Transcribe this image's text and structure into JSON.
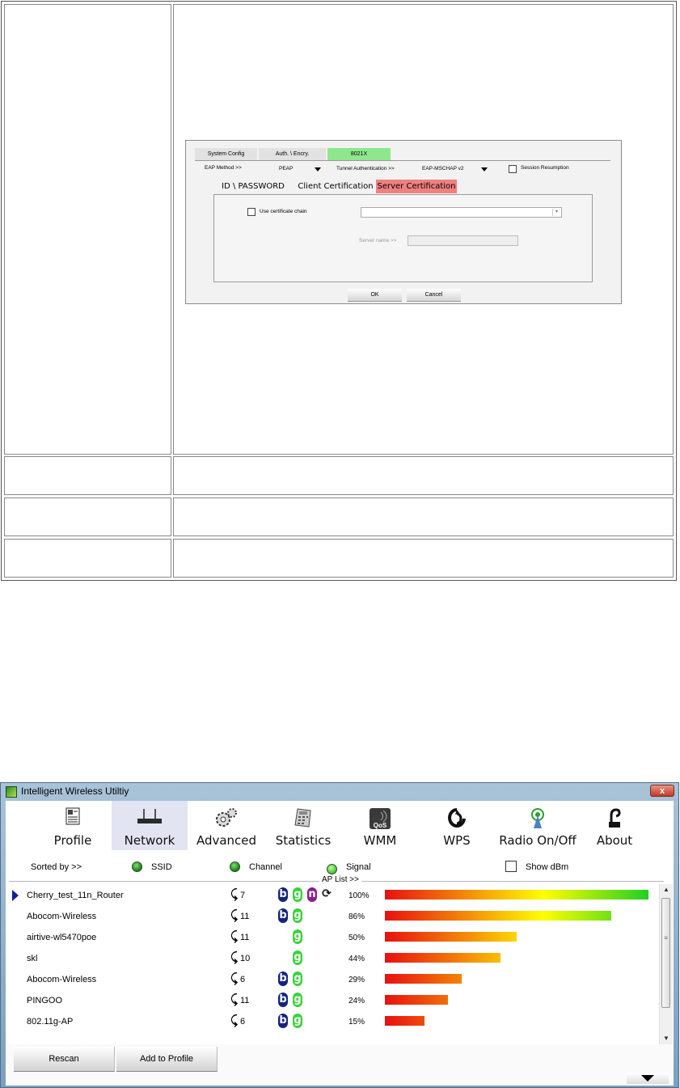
{
  "dialog": {
    "tabs": [
      "System Config",
      "Auth. \\ Encry.",
      "8021X"
    ],
    "eap_method_label": "EAP Method >>",
    "eap_method_value": "PEAP",
    "tunnel_auth_label": "Tunnel Authentication >>",
    "tunnel_auth_value": "EAP-MSCHAP v2",
    "session_resumption_label": "Session Resumption",
    "subtabs": [
      "ID \\ PASSWORD",
      "Client Certification",
      "Server Certification"
    ],
    "use_cert_chain_label": "Use certificate chain",
    "server_name_label": "Server name >>",
    "ok_label": "OK",
    "cancel_label": "Cancel",
    "colors": {
      "active_tab": "#8de88d",
      "server_cert_tab": "#f08080"
    }
  },
  "app": {
    "title": "Intelligent Wireless Utiltiy",
    "close_label": "x",
    "toolbar": [
      {
        "label": "Profile",
        "icon": "profile-icon"
      },
      {
        "label": "Network",
        "icon": "network-icon",
        "active": true
      },
      {
        "label": "Advanced",
        "icon": "advanced-gear-icon"
      },
      {
        "label": "Statistics",
        "icon": "statistics-calculator-icon"
      },
      {
        "label": "WMM",
        "icon": "wmm-qos-icon"
      },
      {
        "label": "WPS",
        "icon": "wps-icon"
      },
      {
        "label": "Radio On/Off",
        "icon": "radio-antenna-icon"
      },
      {
        "label": "About",
        "icon": "about-icon"
      }
    ],
    "sort": {
      "sorted_by": "Sorted by >>",
      "ssid": "SSID",
      "channel": "Channel",
      "signal": "Signal",
      "show_dbm": "Show dBm"
    },
    "ap_list_label": "AP List >>",
    "networks": [
      {
        "ssid": "Cherry_test_11n_Router",
        "channel": "7",
        "modes": [
          "b",
          "g",
          "n",
          "w"
        ],
        "signal": "100%",
        "signal_value": 100,
        "selected": true
      },
      {
        "ssid": "Abocom-Wireless",
        "channel": "11",
        "modes": [
          "b",
          "g"
        ],
        "signal": "86%",
        "signal_value": 86
      },
      {
        "ssid": "airtive-wl5470poe",
        "channel": "11",
        "modes": [
          "g"
        ],
        "signal": "50%",
        "signal_value": 50
      },
      {
        "ssid": "skl",
        "channel": "10",
        "modes": [
          "g"
        ],
        "signal": "44%",
        "signal_value": 44
      },
      {
        "ssid": "Abocom-Wireless",
        "channel": "6",
        "modes": [
          "b",
          "g"
        ],
        "signal": "29%",
        "signal_value": 29
      },
      {
        "ssid": "PINGOO",
        "channel": "11",
        "modes": [
          "b",
          "g"
        ],
        "signal": "24%",
        "signal_value": 24
      },
      {
        "ssid": "802.11g-AP",
        "channel": "6",
        "modes": [
          "b",
          "g"
        ],
        "signal": "15%",
        "signal_value": 15
      }
    ],
    "rescan_label": "Rescan",
    "add_profile_label": "Add to Profile",
    "colors": {
      "bar_low": "#e81010",
      "bar_mid": "#ffff00",
      "bar_high": "#22d022",
      "mode_b": "#15247a",
      "mode_g": "#3ad23a",
      "mode_n": "#8a1f8f"
    }
  }
}
